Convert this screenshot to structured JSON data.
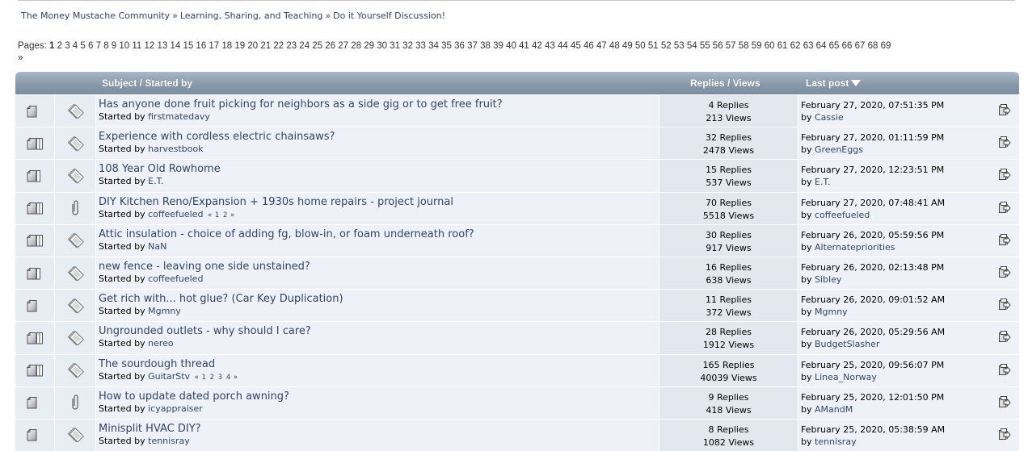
{
  "breadcrumb": {
    "items": [
      "The Money Mustache Community",
      "Learning, Sharing, and Teaching",
      "Do it Yourself Discussion!"
    ],
    "separator": "»"
  },
  "pagination": {
    "label": "Pages:",
    "current": "1",
    "pages": [
      "2",
      "3",
      "4",
      "5",
      "6",
      "7",
      "8",
      "9",
      "10",
      "11",
      "12",
      "13",
      "14",
      "15",
      "16",
      "17",
      "18",
      "19",
      "20",
      "21",
      "22",
      "23",
      "24",
      "25",
      "26",
      "27",
      "28",
      "29",
      "30",
      "31",
      "32",
      "33",
      "34",
      "35",
      "36",
      "37",
      "38",
      "39",
      "40",
      "41",
      "42",
      "43",
      "44",
      "45",
      "46",
      "47",
      "48",
      "49",
      "50",
      "51",
      "52",
      "53",
      "54",
      "55",
      "56",
      "57",
      "58",
      "59",
      "60",
      "61",
      "62",
      "63",
      "64",
      "65",
      "66",
      "67",
      "68",
      "69"
    ],
    "next": "»"
  },
  "table": {
    "headers": {
      "subject": "Subject / Started by",
      "replies": "Replies / Views",
      "last_post": "Last post"
    },
    "started_by_label": "Started by",
    "by_label": "by",
    "rows": [
      {
        "icon": "normal-topic-icon",
        "type": "post-icon",
        "title": "Has anyone done fruit picking for neighbors as a side gig or to get free fruit?",
        "author": "firstmatedavy",
        "pages": [],
        "replies": "4 Replies",
        "views": "213 Views",
        "last_date": "February 27, 2020, 07:51:35 PM",
        "last_by": "Cassie"
      },
      {
        "icon": "very-hot-topic-icon",
        "type": "post-icon",
        "title": "Experience with cordless electric chainsaws?",
        "author": "harvestbook",
        "pages": [],
        "replies": "32 Replies",
        "views": "2478 Views",
        "last_date": "February 27, 2020, 01:11:59 PM",
        "last_by": "GreenEggs"
      },
      {
        "icon": "hot-topic-icon",
        "type": "post-icon",
        "title": "108 Year Old Rowhome",
        "author": "E.T.",
        "pages": [],
        "replies": "15 Replies",
        "views": "537 Views",
        "last_date": "February 27, 2020, 12:23:51 PM",
        "last_by": "E.T."
      },
      {
        "icon": "very-hot-topic-icon",
        "type": "attachment-icon",
        "title": "DIY Kitchen Reno/Expansion + 1930s home repairs - project journal",
        "author": "coffeefueled",
        "pages": [
          "1",
          "2"
        ],
        "replies": "70 Replies",
        "views": "5518 Views",
        "last_date": "February 27, 2020, 07:48:41 AM",
        "last_by": "coffeefueled"
      },
      {
        "icon": "very-hot-topic-icon",
        "type": "post-icon",
        "title": "Attic insulation - choice of adding fg, blow-in, or foam underneath roof?",
        "author": "NaN",
        "pages": [],
        "replies": "30 Replies",
        "views": "917 Views",
        "last_date": "February 26, 2020, 05:59:56 PM",
        "last_by": "Alternatepriorities"
      },
      {
        "icon": "hot-topic-icon",
        "type": "post-icon",
        "title": "new fence - leaving one side unstained?",
        "author": "coffeefueled",
        "pages": [],
        "replies": "16 Replies",
        "views": "638 Views",
        "last_date": "February 26, 2020, 02:13:48 PM",
        "last_by": "Sibley"
      },
      {
        "icon": "normal-topic-icon",
        "type": "post-icon",
        "title": "Get rich with... hot glue? (Car Key Duplication)",
        "author": "Mgmny",
        "pages": [],
        "replies": "11 Replies",
        "views": "372 Views",
        "last_date": "February 26, 2020, 09:01:52 AM",
        "last_by": "Mgmny"
      },
      {
        "icon": "very-hot-topic-icon",
        "type": "post-icon",
        "title": "Ungrounded outlets - why should I care?",
        "author": "nereo",
        "pages": [],
        "replies": "28 Replies",
        "views": "1912 Views",
        "last_date": "February 26, 2020, 05:29:56 AM",
        "last_by": "BudgetSlasher"
      },
      {
        "icon": "very-hot-topic-icon",
        "type": "post-icon",
        "title": "The sourdough thread",
        "author": "GuitarStv",
        "pages": [
          "1",
          "2",
          "3",
          "4"
        ],
        "replies": "165 Replies",
        "views": "40039 Views",
        "last_date": "February 25, 2020, 09:56:07 PM",
        "last_by": "Linea_Norway"
      },
      {
        "icon": "normal-topic-icon",
        "type": "attachment-icon",
        "title": "How to update dated porch awning?",
        "author": "icyappraiser",
        "pages": [],
        "replies": "9 Replies",
        "views": "418 Views",
        "last_date": "February 25, 2020, 12:01:50 PM",
        "last_by": "AMandM"
      },
      {
        "icon": "normal-topic-icon",
        "type": "post-icon",
        "title": "Minisplit HVAC DIY?",
        "author": "tennisray",
        "pages": [],
        "replies": "8 Replies",
        "views": "1082 Views",
        "last_date": "February 25, 2020, 05:38:59 AM",
        "last_by": "tennisray"
      }
    ]
  },
  "colors": {
    "link": "#334466",
    "header_bg": "#8797a9",
    "row_bg": "#eef1f7",
    "stats_bg": "#e3e7ef"
  }
}
